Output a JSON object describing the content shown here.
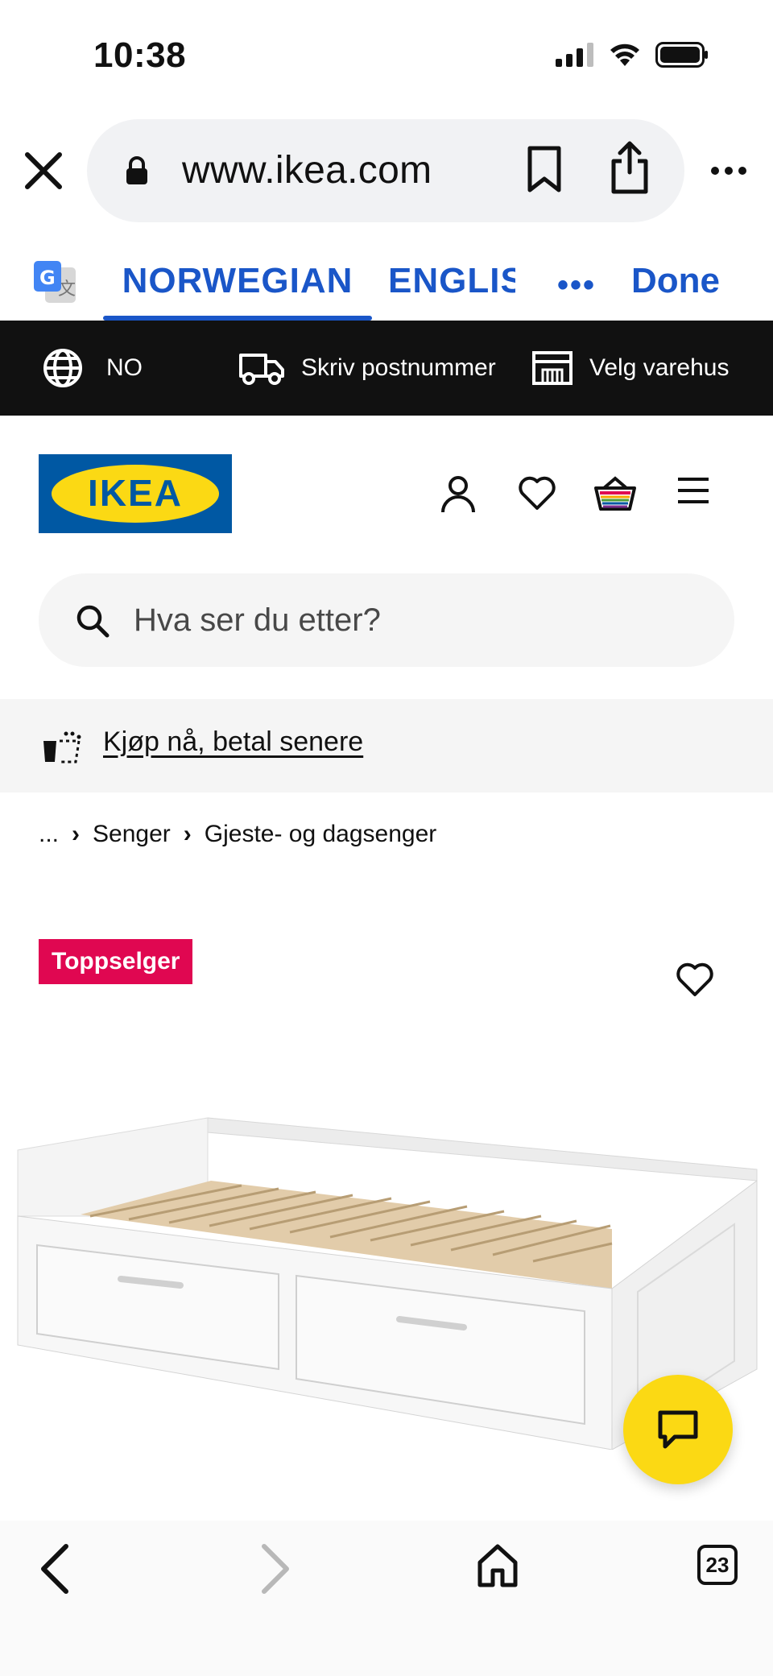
{
  "status_bar": {
    "time": "10:38"
  },
  "browser": {
    "url": "www.ikea.com"
  },
  "translate": {
    "tab_source": "NORWEGIAN",
    "tab_target": "ENGLISH",
    "more": "•••",
    "done": "Done"
  },
  "ikea_strip": {
    "language": "NO",
    "postcode": "Skriv postnummer",
    "store": "Velg varehus"
  },
  "header": {
    "logo_text": "IKEA"
  },
  "search": {
    "placeholder": "Hva ser du etter?"
  },
  "paylater": {
    "label": "Kjøp nå, betal senere"
  },
  "breadcrumb": [
    "...",
    "Senger",
    "Gjeste- og dagsenger"
  ],
  "product": {
    "badge": "Toppselger"
  },
  "bottom_nav": {
    "tabs_count": "23"
  },
  "colors": {
    "ikea_blue": "#0058a3",
    "ikea_yellow": "#fbd914",
    "translate_blue": "#1a56c8",
    "badge_red": "#e00751"
  }
}
